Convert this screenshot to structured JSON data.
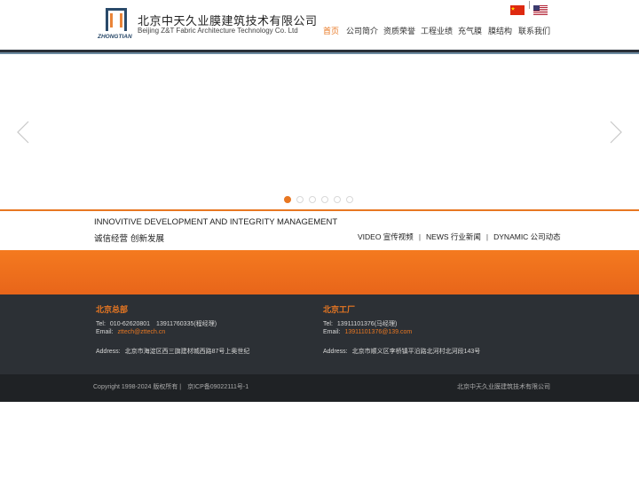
{
  "header": {
    "company_name_cn": "北京中天久业膜建筑技术有限公司",
    "company_name_en": "Beijing Z&T Fabric Architecture Technology Co. Ltd",
    "logo_text": "ZHONGTIAN",
    "language_separator": "|",
    "languages": [
      {
        "icon": "china-flag-icon"
      },
      {
        "icon": "usa-flag-icon"
      }
    ],
    "nav": [
      {
        "label": "首页",
        "active": true
      },
      {
        "label": "公司简介",
        "active": false
      },
      {
        "label": "资质荣誉",
        "active": false
      },
      {
        "label": "工程业绩",
        "active": false
      },
      {
        "label": "充气膜",
        "active": false
      },
      {
        "label": "膜结构",
        "active": false
      },
      {
        "label": "联系我们",
        "active": false
      }
    ]
  },
  "slider": {
    "prev_icon": "chevron-left-icon",
    "next_icon": "chevron-right-icon",
    "active_dot": 0,
    "dot_count": 6
  },
  "motto": {
    "en": "INNOVITIVE DEVELOPMENT AND INTEGRITY MANAGEMENT",
    "cn": "诚信经营 创新发展"
  },
  "sublinks": {
    "separator": "|",
    "items": [
      "VIDEO 宣传视频",
      "NEWS 行业新闻",
      "DYNAMIC 公司动态"
    ]
  },
  "contact": {
    "hq": {
      "title": "北京总部",
      "tel_label": "Tel:",
      "tel_value": "010-62620801　13911760335(程经理)",
      "email_label": "Email:",
      "email_value": "zttech@zttech.cn",
      "address_label": "Address:",
      "address_value": "北京市海淀区西三旗建材城西路87号上奥世纪"
    },
    "factory": {
      "title": "北京工厂",
      "tel_label": "Tel:",
      "tel_value": "13911101376(马经理)",
      "email_label": "Email:",
      "email_value": "13911101376@139.com",
      "address_label": "Address:",
      "address_value": "北京市顺义区李桥镇平沿路北河村北河段143号"
    }
  },
  "footer": {
    "copyright": "Copyright 1998-2024 版权所有 |　京ICP备09022111号-1",
    "company": "北京中天久业膜建筑技术有限公司"
  },
  "colors": {
    "accent": "#e87722",
    "dark": "#2c3035",
    "footer": "#1f2225"
  }
}
